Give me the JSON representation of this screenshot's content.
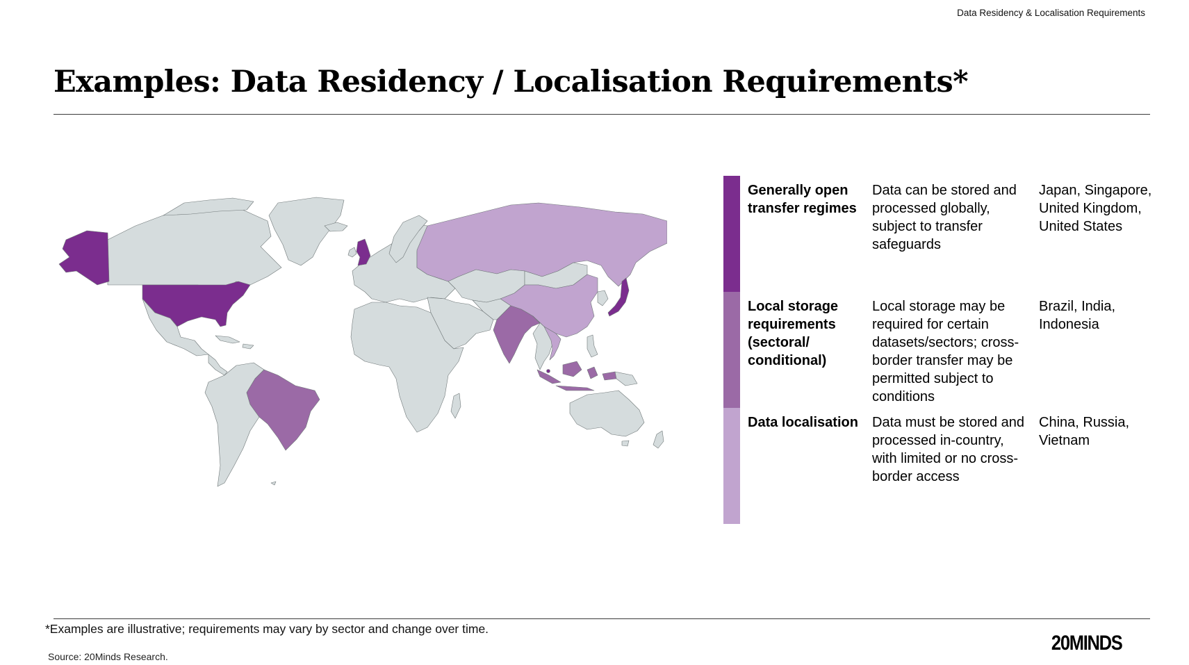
{
  "header": {
    "top_label": "Data Residency & Localisation Requirements",
    "title": "Examples: Data Residency / Localisation Requirements*"
  },
  "colors": {
    "open_regime": "#7b2d8e",
    "local_storage": "#9b6aa6",
    "data_localisation": "#c1a4cf",
    "no_data": "#d5dcdd",
    "border": "#6f7778"
  },
  "legend": [
    {
      "category": "Generally open transfer regimes",
      "description": "Data can be stored and processed globally, subject to transfer safeguards",
      "examples": "Japan, Singapore, United Kingdom, United States",
      "color": "#7b2d8e"
    },
    {
      "category": "Local storage requirements (sectoral/ conditional)",
      "description": "Local storage may be required for certain datasets/sectors; cross-border transfer may be permitted subject to conditions",
      "examples": "Brazil, India, Indonesia",
      "color": "#9b6aa6"
    },
    {
      "category": "Data localisation",
      "description": "Data must be stored and processed in-country, with limited or no cross-border access",
      "examples": "China, Russia, Vietnam",
      "color": "#c1a4cf"
    }
  ],
  "map": {
    "highlighted_countries": [
      {
        "country": "United States",
        "category": "open_regime"
      },
      {
        "country": "United Kingdom",
        "category": "open_regime"
      },
      {
        "country": "Japan",
        "category": "open_regime"
      },
      {
        "country": "Singapore",
        "category": "open_regime"
      },
      {
        "country": "Brazil",
        "category": "local_storage"
      },
      {
        "country": "India",
        "category": "local_storage"
      },
      {
        "country": "Indonesia",
        "category": "local_storage"
      },
      {
        "country": "China",
        "category": "data_localisation"
      },
      {
        "country": "Russia",
        "category": "data_localisation"
      },
      {
        "country": "Vietnam",
        "category": "data_localisation"
      }
    ]
  },
  "footer": {
    "footnote": "*Examples are illustrative; requirements may vary by sector and change over time.",
    "source": "Source: 20Minds Research.",
    "logo_text": "20MINDS"
  }
}
